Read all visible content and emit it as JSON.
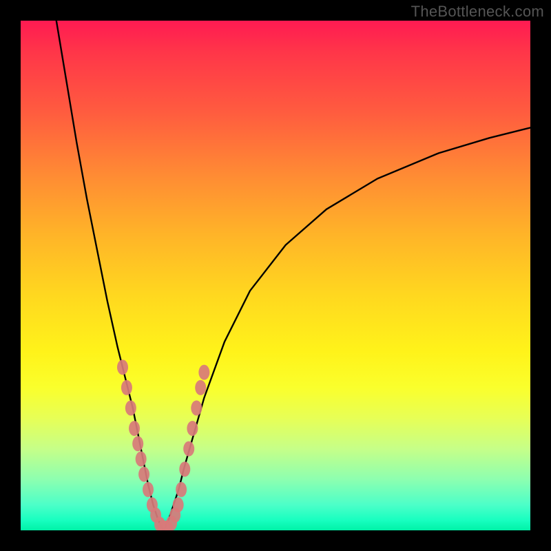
{
  "watermark": "TheBottleneck.com",
  "chart_data": {
    "type": "line",
    "title": "",
    "xlabel": "",
    "ylabel": "",
    "xlim": [
      0,
      100
    ],
    "ylim": [
      0,
      100
    ],
    "series": [
      {
        "name": "left-curve",
        "x": [
          7,
          9,
          11,
          13,
          15,
          17,
          19,
          20.5,
          22,
          23,
          24,
          25,
          26,
          27,
          28
        ],
        "y": [
          100,
          88,
          76,
          65,
          55,
          45,
          36,
          30,
          24,
          19,
          14,
          9,
          5,
          2,
          0
        ]
      },
      {
        "name": "right-curve",
        "x": [
          28,
          29,
          30,
          31,
          32,
          34,
          36,
          40,
          45,
          52,
          60,
          70,
          82,
          92,
          100
        ],
        "y": [
          0,
          2,
          5,
          8,
          12,
          19,
          26,
          37,
          47,
          56,
          63,
          69,
          74,
          77,
          79
        ]
      }
    ],
    "minimum_point": {
      "x": 28,
      "y": 0
    },
    "data_markers": {
      "description": "scatter points along lower portion of curve",
      "color": "#d87a7a",
      "points": [
        {
          "x": 20.0,
          "y": 32
        },
        {
          "x": 20.8,
          "y": 28
        },
        {
          "x": 21.6,
          "y": 24
        },
        {
          "x": 22.3,
          "y": 20
        },
        {
          "x": 23.0,
          "y": 17
        },
        {
          "x": 23.6,
          "y": 14
        },
        {
          "x": 24.2,
          "y": 11
        },
        {
          "x": 25.0,
          "y": 8
        },
        {
          "x": 25.8,
          "y": 5
        },
        {
          "x": 26.5,
          "y": 3
        },
        {
          "x": 27.3,
          "y": 1.2
        },
        {
          "x": 28.0,
          "y": 0.5
        },
        {
          "x": 28.8,
          "y": 0.5
        },
        {
          "x": 29.6,
          "y": 1.4
        },
        {
          "x": 30.3,
          "y": 3
        },
        {
          "x": 30.9,
          "y": 5
        },
        {
          "x": 31.5,
          "y": 8
        },
        {
          "x": 32.2,
          "y": 12
        },
        {
          "x": 33.0,
          "y": 16
        },
        {
          "x": 33.7,
          "y": 20
        },
        {
          "x": 34.5,
          "y": 24
        },
        {
          "x": 35.3,
          "y": 28
        },
        {
          "x": 36.0,
          "y": 31
        }
      ]
    }
  }
}
